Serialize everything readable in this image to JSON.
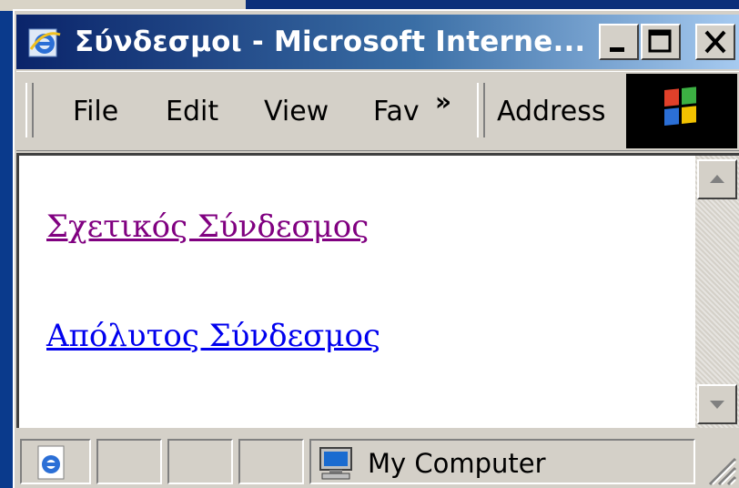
{
  "window": {
    "title": "Σύνδεσμοι - Microsoft Interne..."
  },
  "titlebar_buttons": {
    "minimize": "minimize-icon",
    "maximize": "maximize-icon",
    "close": "close-icon"
  },
  "menu": {
    "items": [
      {
        "label": "File"
      },
      {
        "label": "Edit"
      },
      {
        "label": "View"
      },
      {
        "label": "Fav"
      }
    ],
    "overflow_label": "»",
    "address_label": "Address"
  },
  "content": {
    "links": [
      {
        "label": "Σχετικός Σύνδεσμος",
        "visited": true,
        "color": "#800080"
      },
      {
        "label": "Απόλυτος Σύνδεσμος",
        "visited": false,
        "color": "#0000ee"
      }
    ]
  },
  "statusbar": {
    "zone_label": "My Computer",
    "zone_icon": "computer-icon",
    "page_icon": "ie-page-icon"
  },
  "colors": {
    "title_gradient_start": "#0a246a",
    "title_gradient_end": "#a6caf0",
    "chrome": "#d4d0c8"
  }
}
